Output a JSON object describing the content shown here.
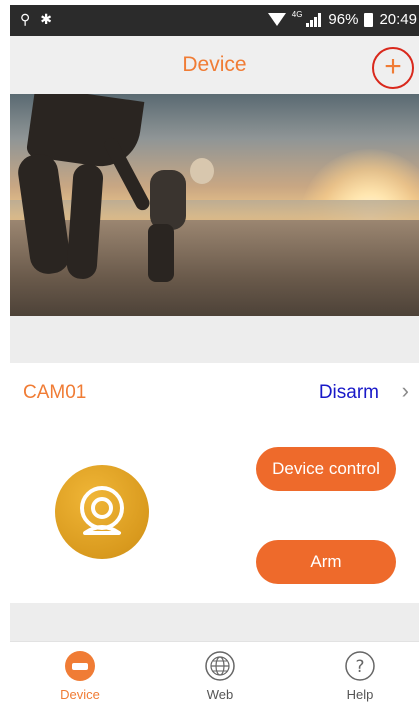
{
  "status_bar": {
    "battery_percent": "96%",
    "time": "20:49",
    "network": "4G"
  },
  "header": {
    "title": "Device",
    "add_label": "+"
  },
  "device": {
    "name": "CAM01",
    "arm_state": "Disarm",
    "chevron": "›",
    "control_label": "Device control",
    "arm_label": "Arm"
  },
  "tabs": [
    {
      "label": "Device",
      "icon": "device-icon",
      "active": true
    },
    {
      "label": "Web",
      "icon": "globe-icon",
      "active": false
    },
    {
      "label": "Help",
      "icon": "help-icon",
      "active": false
    }
  ],
  "colors": {
    "accent": "#f07c35",
    "button": "#ee6a2b",
    "link": "#1919c8",
    "status_bar": "#2b2b2b"
  }
}
